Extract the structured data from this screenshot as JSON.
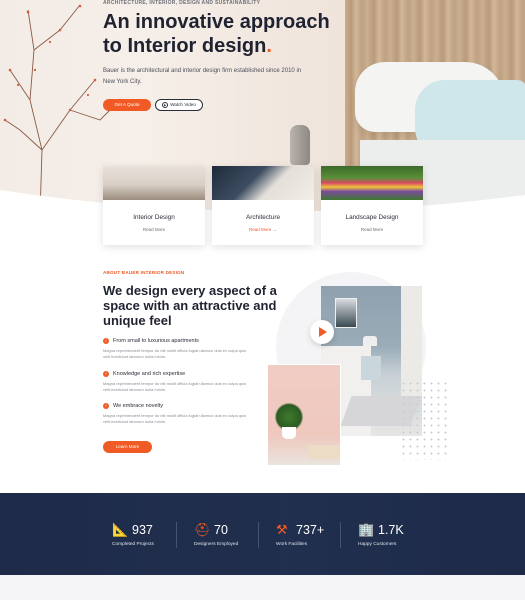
{
  "hero": {
    "tagline": "Architecture, Interior, Design and Sustainability",
    "title_line1": "An innovative approach",
    "title_line2_prefix": "to ",
    "title_line2_bold": "Interior design",
    "title_dot": ".",
    "description": "Bauer is the architectural and interior design firm established since 2010 in New York City.",
    "btn_quote": "Get A Quote",
    "btn_video": "Watch Video"
  },
  "services": [
    {
      "title": "Interior Design",
      "link": "Read More"
    },
    {
      "title": "Architecture",
      "link": "Read More →"
    },
    {
      "title": "Landscape Design",
      "link": "Read More"
    }
  ],
  "about": {
    "tag": "About Bauer Interior Design",
    "title_we": "We ",
    "title_design": "design",
    "title_mid": " every aspect of a space with an attractive and ",
    "title_unique": "unique feel",
    "features": [
      {
        "heading": "From small to luxurious apartments",
        "text": "Magna reprehenderit tempor do elit mollit officia fugiat ullamco duis ex culpa quis velit incididunt laborum nulla minim."
      },
      {
        "heading": "Knowledge and rich expertise",
        "text": "Magna reprehenderit tempor do elit mollit officia fugiat ullamco duis ex culpa quis velit incididunt laborum nulla minim."
      },
      {
        "heading": "We embrace novelty",
        "text": "Magna reprehenderit tempor do elit mollit officia fugiat ullamco duis ex culpa quis velit incididunt laborum nulla minim."
      }
    ],
    "btn_more": "Learn More"
  },
  "stats": [
    {
      "icon": "ruler-pencil-icon",
      "number": "937",
      "label": "Completed Projects"
    },
    {
      "icon": "helmet-icon",
      "number": "70",
      "label": "Designers Employed"
    },
    {
      "icon": "tools-icon",
      "number": "737+",
      "label": "Work Facilities"
    },
    {
      "icon": "building-icon",
      "number": "1.7K",
      "label": "Happy Customers"
    }
  ],
  "colors": {
    "accent": "#f15a24",
    "navy": "#1d2a48"
  }
}
